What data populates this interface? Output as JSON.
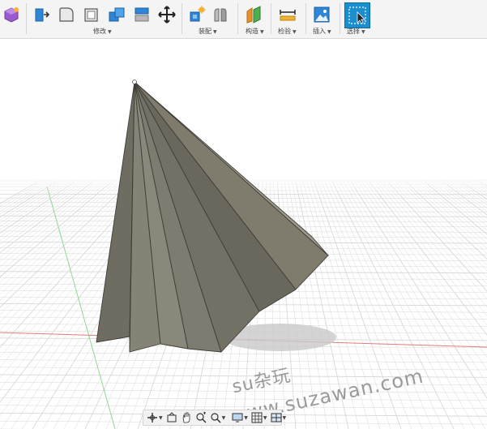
{
  "toolbar": {
    "groups": {
      "modify": "修改",
      "assemble": "装配",
      "construct": "构造",
      "inspect": "检验",
      "insert": "插入",
      "select": "选择"
    }
  },
  "watermark": {
    "line1": "su杂玩",
    "line2": "www.suzawan.com"
  },
  "colors": {
    "accent_blue": "#1f7fd6",
    "select_blue": "#1a8fd0",
    "model_face": "#7b786b",
    "grid_line": "#d8d8d8",
    "axis_red": "#e36a6a",
    "axis_green": "#7fd07f"
  },
  "icons": {
    "create_form": "create-form-icon",
    "press_pull": "press-pull-icon",
    "fillet": "fillet-icon",
    "shell": "shell-icon",
    "combine": "combine-icon",
    "split_body": "split-body-icon",
    "move": "move-icon",
    "new_component": "new-component-icon",
    "joint": "joint-icon",
    "offset_plane": "offset-plane-icon",
    "measure": "measure-icon",
    "insert_image": "insert-image-icon",
    "select": "select-icon",
    "orbit": "orbit-icon",
    "look_at": "look-at-icon",
    "pan": "pan-icon",
    "zoom_window": "zoom-window-icon",
    "fit": "fit-icon",
    "display_settings": "display-settings-icon",
    "grid_settings": "grid-settings-icon",
    "viewports": "viewports-icon"
  }
}
